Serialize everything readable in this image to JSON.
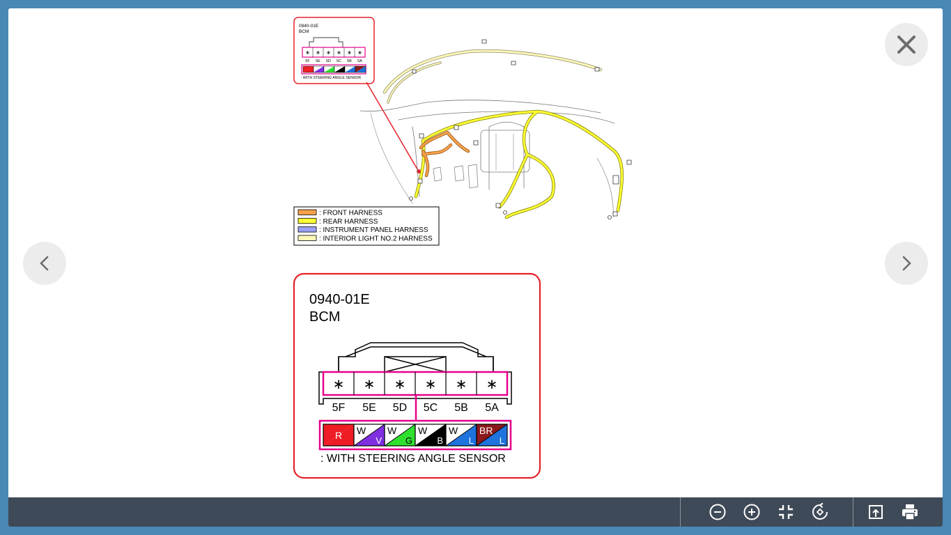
{
  "diagram": {
    "connector_id": "0940-01E",
    "connector_name": "BCM",
    "pins": [
      "5F",
      "5E",
      "5D",
      "5C",
      "5B",
      "5A"
    ],
    "pin_mark": "∗",
    "wires": [
      {
        "top": "R",
        "bottom": "",
        "color1": "#ee1c24",
        "color2": "#ee1c24"
      },
      {
        "top": "W",
        "bottom": "V",
        "color1": "#ffffff",
        "color2": "#7f2fe0"
      },
      {
        "top": "W",
        "bottom": "G",
        "color1": "#ffffff",
        "color2": "#2fe02f"
      },
      {
        "top": "W",
        "bottom": "B",
        "color1": "#ffffff",
        "color2": "#000000"
      },
      {
        "top": "W",
        "bottom": "L",
        "color1": "#ffffff",
        "color2": "#1e73dc"
      },
      {
        "top": "BR",
        "bottom": "L",
        "color1": "#8b1a1a",
        "color2": "#1e73dc"
      }
    ],
    "note": ": WITH STEERING ANGLE SENSOR",
    "legend": [
      {
        "label": ": FRONT HARNESS",
        "color": "#f7a14a"
      },
      {
        "label": ": REAR HARNESS",
        "color": "#ffff33"
      },
      {
        "label": ": INSTRUMENT PANEL HARNESS",
        "color": "#9aa0f5"
      },
      {
        "label": ": INTERIOR LIGHT NO.2 HARNESS",
        "color": "#fdf7b8"
      }
    ],
    "colors": {
      "highlight": "#e6008a",
      "callout": "#e8202a",
      "rear_harness": "#e8e000",
      "front_harness": "#f08a2a"
    }
  },
  "toolbar": {
    "buttons": [
      "zoom-out-icon",
      "zoom-in-icon",
      "fit-screen-icon",
      "rotate-icon",
      "open-external-icon",
      "print-icon"
    ]
  },
  "nav": {
    "close": "close-icon",
    "prev": "chevron-left-icon",
    "next": "chevron-right-icon"
  }
}
